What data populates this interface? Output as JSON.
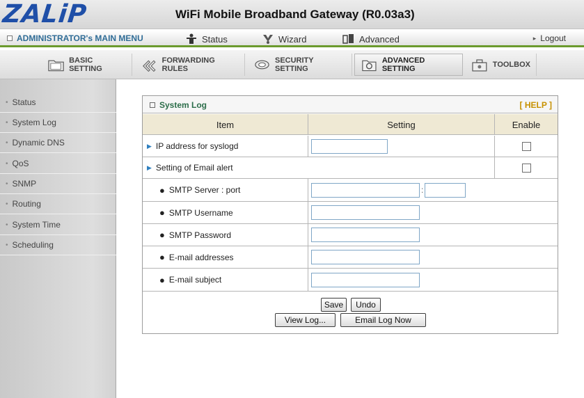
{
  "header": {
    "logo": "ZALiP",
    "title": "WiFi Mobile Broadband Gateway (R0.03a3)"
  },
  "mainnav": {
    "admin": "ADMINISTRATOR's MAIN MENU",
    "status": "Status",
    "wizard": "Wizard",
    "advanced": "Advanced",
    "logout": "Logout",
    "logout_arrow": "▸"
  },
  "tabs": [
    {
      "label": "BASIC SETTING",
      "icon": "folder-icon"
    },
    {
      "label": "FORWARDING RULES",
      "icon": "arrows-icon"
    },
    {
      "label": "SECURITY SETTING",
      "icon": "lock-icon"
    },
    {
      "label": "ADVANCED SETTING",
      "icon": "gear-folder-icon",
      "active": true
    },
    {
      "label": "TOOLBOX",
      "icon": "toolbox-icon"
    }
  ],
  "sidebar": {
    "items": [
      {
        "label": "Status"
      },
      {
        "label": "System Log"
      },
      {
        "label": "Dynamic DNS"
      },
      {
        "label": "QoS"
      },
      {
        "label": "SNMP"
      },
      {
        "label": "Routing"
      },
      {
        "label": "System Time"
      },
      {
        "label": "Scheduling"
      }
    ]
  },
  "panel": {
    "title": "System Log",
    "help": "[ HELP ]",
    "columns": {
      "item": "Item",
      "setting": "Setting",
      "enable": "Enable"
    },
    "rows": {
      "syslogd": {
        "label": "IP address for syslogd",
        "value": "",
        "enabled": false
      },
      "email_alert": {
        "label": "Setting of Email alert",
        "enabled": false
      },
      "smtp_server": {
        "label": "SMTP Server : port",
        "server": "",
        "separator": ":",
        "port": ""
      },
      "smtp_user": {
        "label": "SMTP Username",
        "value": ""
      },
      "smtp_pass": {
        "label": "SMTP Password",
        "value": ""
      },
      "emails": {
        "label": "E-mail addresses",
        "value": ""
      },
      "subject": {
        "label": "E-mail subject",
        "value": ""
      }
    },
    "buttons": {
      "save": "Save",
      "undo": "Undo",
      "view_log": "View Log...",
      "email_log": "Email Log Now"
    }
  }
}
